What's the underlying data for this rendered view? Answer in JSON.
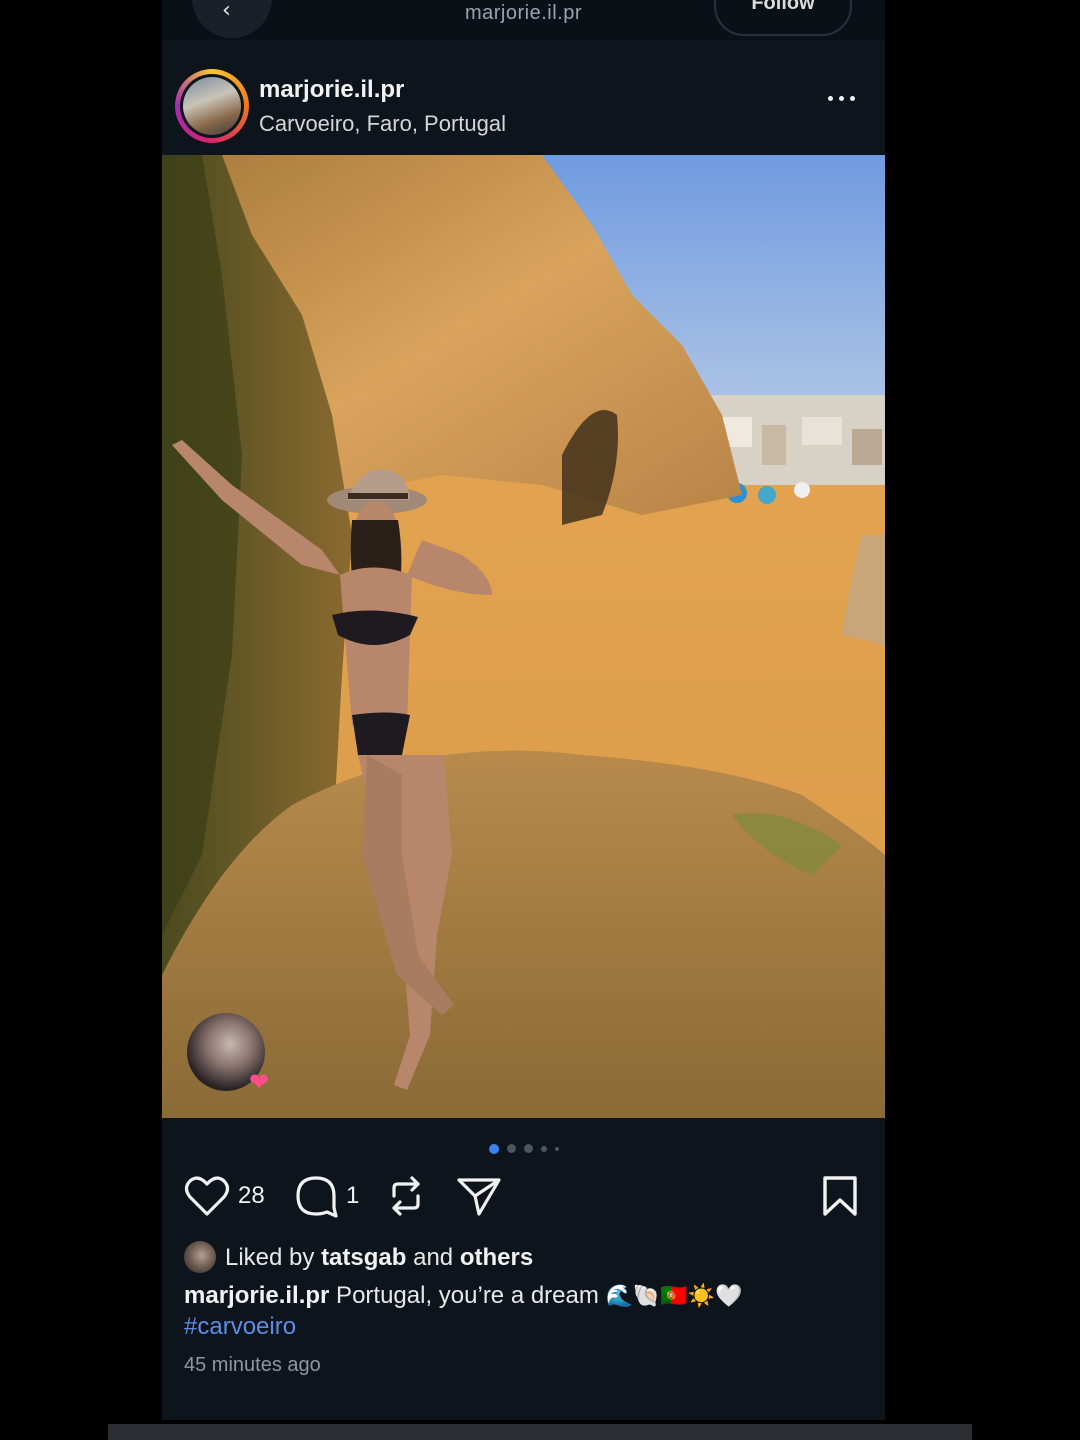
{
  "nav": {
    "title": "marjorie.il.pr",
    "back_icon": "chevron-left-icon",
    "follow_label": "Follow"
  },
  "post": {
    "username": "marjorie.il.pr",
    "location": "Carvoeiro, Faro, Portugal",
    "more_icon": "more-horizontal-icon",
    "carousel": {
      "total": 5,
      "active_index": 0
    },
    "likes_count": "28",
    "comments_count": "1",
    "liked_by_prefix": "Liked by ",
    "liked_by_user": "tatsgab",
    "liked_by_suffix": " and ",
    "liked_by_others": "others",
    "caption_user": "marjorie.il.pr",
    "caption_text": " Portugal, you’re a dream ",
    "caption_emojis": "🌊🐚🇵🇹☀️🤍",
    "hashtag": "#carvoeiro",
    "timestamp": "45 minutes ago"
  },
  "colors": {
    "background": "#0e141b",
    "accent": "#3b82f6",
    "hashtag": "#5c8de6",
    "heart": "#ff4d8d"
  },
  "icons": [
    "heart-icon",
    "comment-icon",
    "repost-icon",
    "send-icon",
    "bookmark-icon"
  ]
}
